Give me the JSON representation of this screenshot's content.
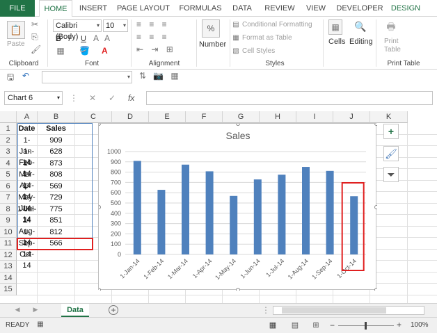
{
  "ribbon_tabs": [
    "FILE",
    "HOME",
    "INSERT",
    "PAGE LAYOUT",
    "FORMULAS",
    "DATA",
    "REVIEW",
    "VIEW",
    "DEVELOPER",
    "DESIGN"
  ],
  "ribbon": {
    "paste_label": "Paste",
    "font_name": "Calibri (Body)",
    "font_size": "10",
    "number_label": "Number",
    "percent_symbol": "%",
    "conditional_formatting": "Conditional Formatting",
    "format_as_table": "Format as Table",
    "cell_styles": "Cell Styles",
    "cells_label": "Cells",
    "editing_label": "Editing",
    "print_table_label": "Print Table",
    "print_line1": "Print",
    "print_line2": "Table",
    "groups": {
      "clipboard": "Clipboard",
      "font": "Font",
      "alignment": "Alignment",
      "styles": "Styles",
      "print_table": "Print Table"
    },
    "bold": "B",
    "italic": "I",
    "underline": "U",
    "font_color_letter": "A"
  },
  "namebox": "Chart 6",
  "fx_label": "fx",
  "columns": [
    "A",
    "B",
    "C",
    "D",
    "E",
    "F",
    "G",
    "H",
    "I",
    "J",
    "K"
  ],
  "rows": [
    "1",
    "2",
    "3",
    "4",
    "5",
    "6",
    "7",
    "8",
    "9",
    "10",
    "11",
    "12",
    "13",
    "14",
    "15"
  ],
  "table": {
    "headers": [
      "Date",
      "Sales"
    ],
    "rows": [
      [
        "1-Jan-14",
        "909"
      ],
      [
        "1-Feb-14",
        "628"
      ],
      [
        "1-Mar-14",
        "873"
      ],
      [
        "1-Apr-14",
        "808"
      ],
      [
        "1-May-14",
        "569"
      ],
      [
        "1-Jun-14",
        "729"
      ],
      [
        "1-Jul-14",
        "775"
      ],
      [
        "1-Aug-14",
        "851"
      ],
      [
        "1-Sep-14",
        "812"
      ],
      [
        "1-Oct-14",
        "566"
      ]
    ]
  },
  "chart_data": {
    "type": "bar",
    "title": "Sales",
    "categories": [
      "1-Jan-14",
      "1-Feb-14",
      "1-Mar-14",
      "1-Apr-14",
      "1-May-14",
      "1-Jun-14",
      "1-Jul-14",
      "1-Aug-14",
      "1-Sep-14",
      "1-Oct-14"
    ],
    "values": [
      909,
      628,
      873,
      808,
      569,
      729,
      775,
      851,
      812,
      566
    ],
    "ylim": [
      0,
      1000
    ],
    "yticks": [
      "0",
      "100",
      "200",
      "300",
      "400",
      "500",
      "600",
      "700",
      "800",
      "900",
      "1000"
    ],
    "grid": true,
    "color": "#4f81bd",
    "highlight": "1-Oct-14"
  },
  "sheet_tab": "Data",
  "status": {
    "ready": "READY",
    "zoom": "100%",
    "minus": "−",
    "plus": "+"
  },
  "colors": {
    "excel_green": "#217346",
    "highlight_red": "#e02020",
    "bar_blue": "#4f81bd"
  }
}
